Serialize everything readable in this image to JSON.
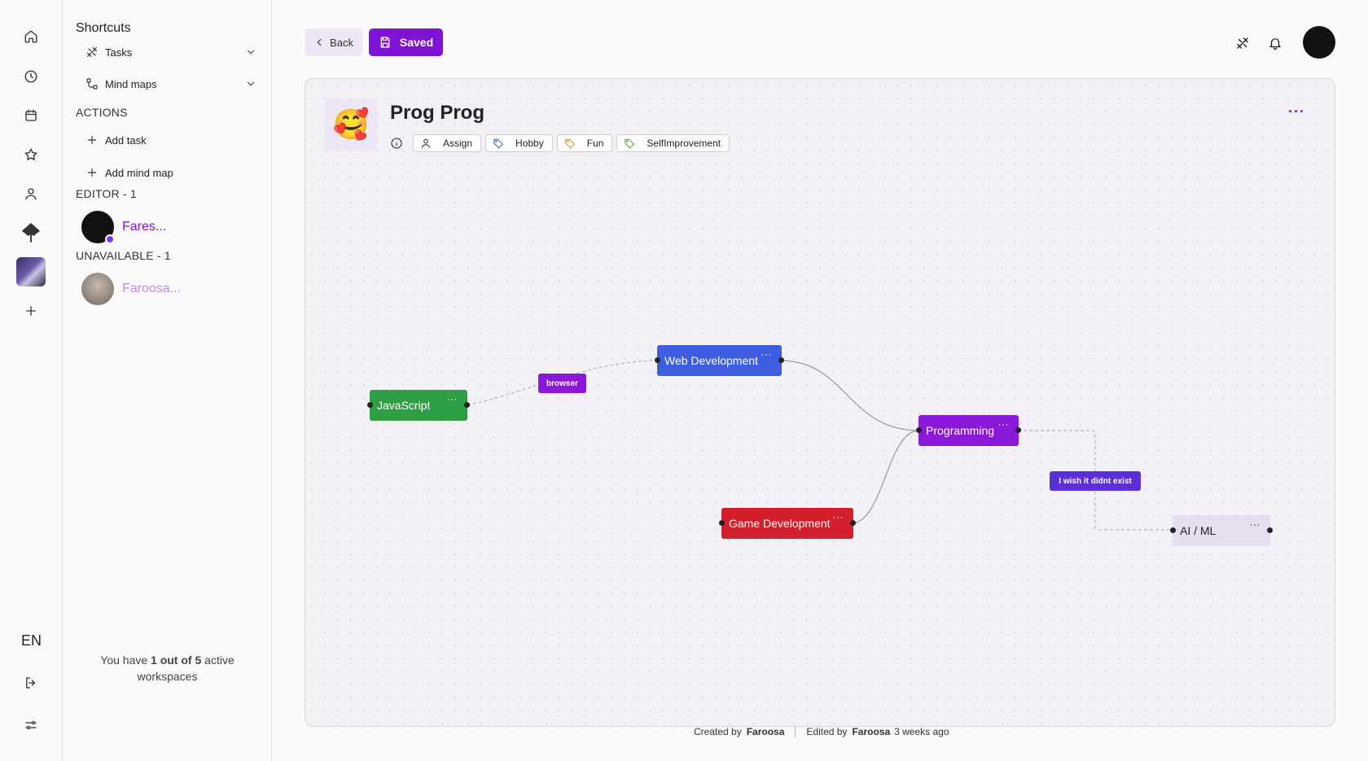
{
  "rail": {
    "items": [
      {
        "icon": "home-icon"
      },
      {
        "icon": "clock-icon"
      },
      {
        "icon": "calendar-icon"
      },
      {
        "icon": "star-icon"
      },
      {
        "icon": "user-icon"
      },
      {
        "icon": "app-logo-icon"
      },
      {
        "icon": "workspace-avatar"
      },
      {
        "icon": "plus-icon"
      }
    ],
    "language": "EN"
  },
  "sidebar": {
    "shortcuts_title": "Shortcuts",
    "shortcuts": [
      {
        "label": "Tasks",
        "icon": "tasks-icon"
      },
      {
        "label": "Mind maps",
        "icon": "mindmap-icon"
      }
    ],
    "actions_title": "ACTIONS",
    "actions": [
      {
        "label": "Add task"
      },
      {
        "label": "Add mind map"
      }
    ],
    "editor_title": "EDITOR - 1",
    "editor_member": "Fares...",
    "unavailable_title": "UNAVAILABLE - 1",
    "unavailable_member": "Faroosa...",
    "workspaces_note": {
      "prefix": "You have ",
      "count": "1 out of 5",
      "suffix": " active workspaces"
    }
  },
  "toolbar": {
    "back_label": "Back",
    "saved_label": "Saved"
  },
  "header_icons": [
    "tools-icon",
    "bell-icon",
    "user-avatar"
  ],
  "mindmap": {
    "emoji": "🥰",
    "title": "Prog Prog",
    "chips": [
      {
        "label": "Assign",
        "icon": "user-icon",
        "color": "#222222"
      },
      {
        "label": "Hobby",
        "icon": "tag-icon",
        "color": "#2b55d6"
      },
      {
        "label": "Fun",
        "icon": "tag-icon",
        "color": "#d68a12"
      },
      {
        "label": "SelfImprovement",
        "icon": "tag-icon",
        "color": "#4a9a2a"
      }
    ],
    "more": "···",
    "nodes": {
      "javascript": {
        "label": "JavaScript",
        "color": "#2e9e44",
        "dots": "···"
      },
      "webdev": {
        "label": "Web Development",
        "color": "#3f5de0",
        "dots": "···"
      },
      "programming": {
        "label": "Programming",
        "color": "#8a18d8",
        "dots": "···"
      },
      "gamedev": {
        "label": "Game Development",
        "color": "#d31f2c",
        "dots": "···"
      },
      "aiml": {
        "label": "AI / ML",
        "color": "#e7ddf1",
        "dots": "···"
      }
    },
    "edge_labels": {
      "browser": {
        "label": "browser",
        "color": "#8a18d8"
      },
      "wish": {
        "label": "I wish it didnt exist",
        "color": "#5b2fd6"
      }
    }
  },
  "footer": {
    "created_prefix": "Created by",
    "created_by": "Faroosa",
    "edited_prefix": "Edited by",
    "edited_by": "Faroosa",
    "edited_when": "3 weeks ago"
  }
}
